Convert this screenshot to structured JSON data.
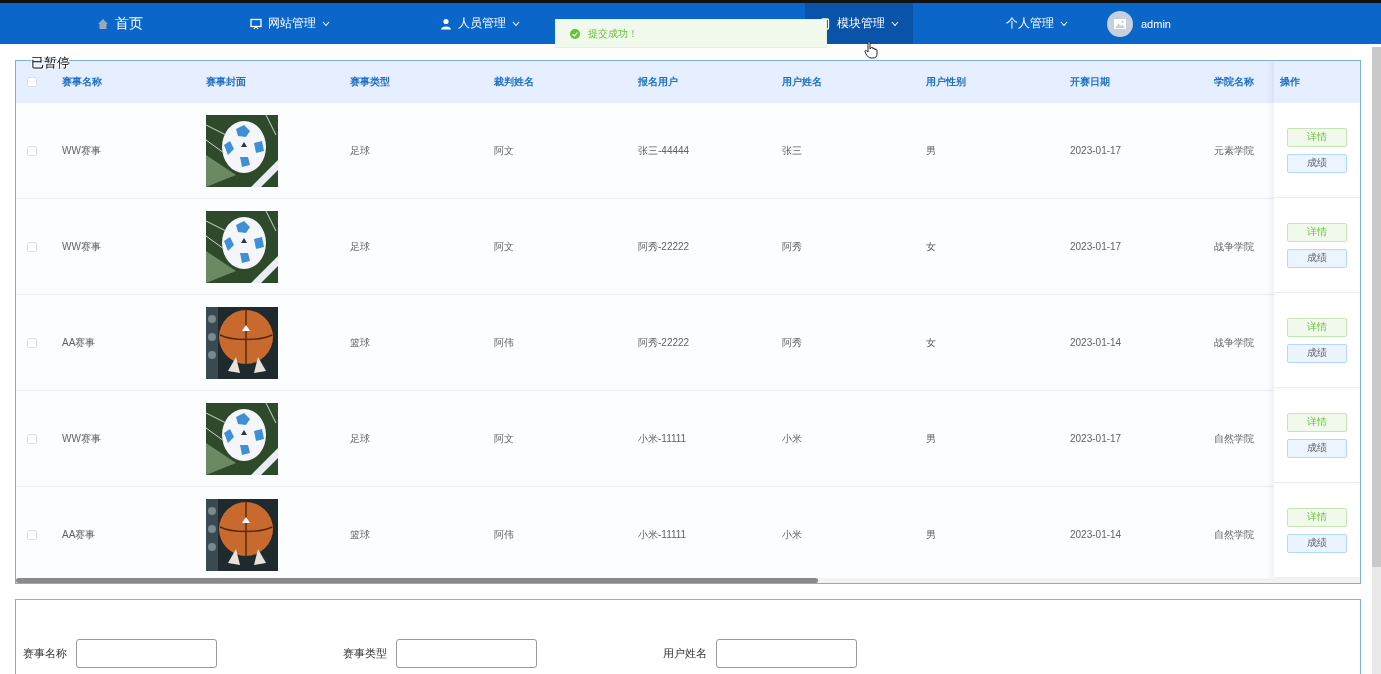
{
  "nav": {
    "items": [
      {
        "label": "首页",
        "dropdown": false,
        "selected": false
      },
      {
        "label": "网站管理",
        "dropdown": true,
        "selected": false
      },
      {
        "label": "人员管理",
        "dropdown": true,
        "selected": false
      },
      {
        "label": "模块管理",
        "dropdown": true,
        "selected": true
      },
      {
        "label": "个人管理",
        "dropdown": true,
        "selected": false
      }
    ],
    "user": {
      "name": "admin"
    }
  },
  "toast": {
    "message": "提交成功！"
  },
  "overlay_label": "已暂停",
  "table": {
    "select_all": {
      "checked": false
    },
    "columns": [
      "赛事名称",
      "赛事封面",
      "赛事类型",
      "裁判姓名",
      "报名用户",
      "用户姓名",
      "用户性别",
      "开赛日期",
      "学院名称",
      "操作"
    ],
    "rows": [
      {
        "checked": false,
        "name": "WW赛事",
        "cover": {
          "kind": "picture"
        },
        "type": "足球",
        "judge": "阿文",
        "user": "张三-44444",
        "user_name": "张三",
        "gender": "男",
        "date": "2023-01-17",
        "college": "元素学院",
        "actions": [
          "详情",
          "成绩"
        ]
      },
      {
        "checked": false,
        "name": "WW赛事",
        "cover": {
          "kind": "picture"
        },
        "type": "足球",
        "judge": "阿文",
        "user": "阿秀-22222",
        "user_name": "阿秀",
        "gender": "女",
        "date": "2023-01-17",
        "college": "战争学院",
        "actions": [
          "详情",
          "成绩"
        ]
      },
      {
        "checked": false,
        "name": "AA赛事",
        "cover": {
          "kind": "picture"
        },
        "type": "篮球",
        "judge": "阿伟",
        "user": "阿秀-22222",
        "user_name": "阿秀",
        "gender": "女",
        "date": "2023-01-14",
        "college": "战争学院",
        "actions": [
          "详情",
          "成绩"
        ]
      },
      {
        "checked": false,
        "name": "WW赛事",
        "cover": {
          "kind": "picture"
        },
        "type": "足球",
        "judge": "阿文",
        "user": "小米-11111",
        "user_name": "小米",
        "gender": "男",
        "date": "2023-01-17",
        "college": "自然学院",
        "actions": [
          "详情",
          "成绩"
        ]
      },
      {
        "checked": false,
        "name": "AA赛事",
        "cover": {
          "kind": "picture"
        },
        "type": "篮球",
        "judge": "阿伟",
        "user": "小米-11111",
        "user_name": "小米",
        "gender": "男",
        "date": "2023-01-14",
        "college": "自然学院",
        "actions": [
          "详情",
          "成绩"
        ]
      }
    ]
  },
  "search": {
    "fields": [
      {
        "label": "赛事名称"
      },
      {
        "label": "赛事类型"
      },
      {
        "label": "用户姓名"
      }
    ]
  }
}
